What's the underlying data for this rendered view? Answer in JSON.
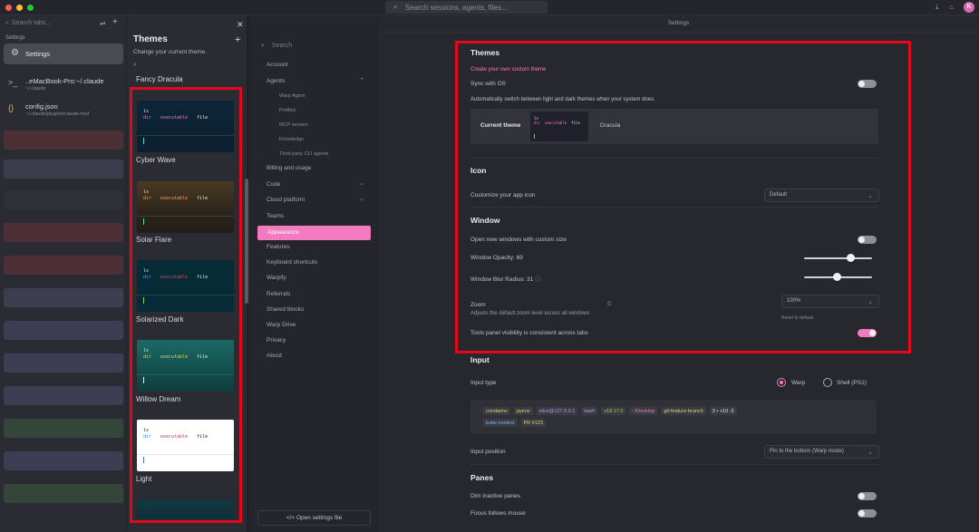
{
  "topbar": {
    "search_placeholder": "Search sessions, agents, files...",
    "avatar_letter": "K"
  },
  "tabs_sidebar": {
    "search_placeholder": "Search tabs...",
    "group_label": "Settings",
    "settings_tab": "Settings",
    "terminal_tab": {
      "title": "..eMacBook-Pro:~/.claude",
      "path": "~/.claude"
    },
    "file_tab": {
      "title": "config.json",
      "path": "~/.claude/plugins/claude-hud"
    }
  },
  "themes_panel": {
    "title": "Themes",
    "subtitle": "Change your current theme.",
    "first_item": "Fancy Dracula",
    "preview": {
      "cmd": "ls",
      "dir": "dir",
      "exec": "executable",
      "file": "file"
    },
    "themes": [
      {
        "name": "Cyber Wave"
      },
      {
        "name": "Solar Flare"
      },
      {
        "name": "Solarized Dark"
      },
      {
        "name": "Willow Dream"
      },
      {
        "name": "Light"
      }
    ]
  },
  "nav": {
    "search_placeholder": "Search",
    "items": {
      "account": "Account",
      "agents": "Agents",
      "warp_agent": "Warp Agent",
      "profiles": "Profiles",
      "mcp": "MCP servers",
      "knowledge": "Knowledge",
      "third_party": "Third party CLI agents",
      "billing": "Billing and usage",
      "code": "Code",
      "cloud": "Cloud platform",
      "teams": "Teams",
      "appearance": "Appearance",
      "features": "Features",
      "keyboard": "Keyboard shortcuts",
      "warpify": "Warpify",
      "referrals": "Referrals",
      "shared_blocks": "Shared blocks",
      "warp_drive": "Warp Drive",
      "privacy": "Privacy",
      "about": "About"
    },
    "open_file": "Open settings file"
  },
  "main": {
    "title": "Settings",
    "themes": {
      "heading": "Themes",
      "create_link": "Create your own custom theme",
      "sync_label": "Sync with OS",
      "sync_on": false,
      "sync_desc": "Automatically switch between light and dark themes when your system does.",
      "current_label": "Current theme",
      "current_value": "Dracula"
    },
    "icon": {
      "heading": "Icon",
      "label": "Customize your app icon",
      "value": "Default"
    },
    "window": {
      "heading": "Window",
      "custom_size_label": "Open new windows with custom size",
      "custom_size_on": false,
      "opacity_label": "Window Opacity: 69",
      "opacity_value": 69,
      "blur_label": "Window Blur Radius: 31",
      "blur_value": 31,
      "zoom_label": "Zoom",
      "zoom_desc": "Adjusts the default zoom level across all windows",
      "zoom_value": "100%",
      "zoom_reset": "Reset to default",
      "tools_label": "Tools panel visibility is consistent across tabs",
      "tools_on": true
    },
    "input": {
      "heading": "Input",
      "type_label": "Input type",
      "opt_warp": "Warp",
      "opt_shell": "Shell (PS1)",
      "selected": "Warp",
      "chips": [
        {
          "text": "condaenv",
          "color": "#e9d36c"
        },
        {
          "text": "pyenv",
          "color": "#e9d36c"
        },
        {
          "text": "alice@127.0.0.1",
          "color": "#b49ae8"
        },
        {
          "text": "bash",
          "color": "#b49ae8"
        },
        {
          "text": "v18.17.0",
          "color": "#9fd36c"
        },
        {
          "text": "~/Desktop",
          "color": "#f27bbf"
        },
        {
          "text": "git-feature-branch",
          "color": "#e9d36c"
        },
        {
          "text": "3 • +10 -2",
          "color": "#e6e6ea"
        },
        {
          "text": "kube-context",
          "color": "#7ab8f0"
        },
        {
          "text": "PR #123",
          "color": "#e9d36c"
        }
      ],
      "position_label": "Input position",
      "position_value": "Pin to the bottom (Warp mode)"
    },
    "panes": {
      "heading": "Panes",
      "dim_label": "Dim inactive panes",
      "dim_on": false,
      "focus_label": "Focus follows mouse",
      "focus_on": false
    }
  },
  "colors": {
    "accent": "#f27bbf",
    "highlight": "#e5071a"
  }
}
